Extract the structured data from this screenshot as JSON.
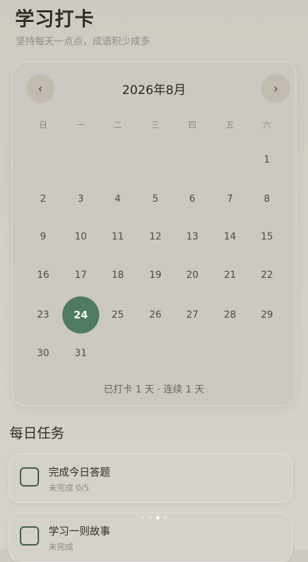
{
  "header": {
    "title": "学习打卡",
    "subtitle": "坚持每天一点点，成语积少成多"
  },
  "calendar": {
    "month_label": "2026年8月",
    "prev_icon": "chevron-left-icon",
    "next_icon": "chevron-right-icon",
    "prev_glyph": "‹",
    "next_glyph": "›",
    "weekdays": [
      "日",
      "一",
      "二",
      "三",
      "四",
      "五",
      "六"
    ],
    "first_weekday_index": 6,
    "days_in_month": 31,
    "selected_day": 24,
    "summary": "已打卡 1 天 · 连续 1 天"
  },
  "tasks_section": {
    "title": "每日任务",
    "tasks": [
      {
        "title": "完成今日答题",
        "status": "未完成 0/5"
      },
      {
        "title": "学习一则故事",
        "status": "未完成"
      }
    ]
  },
  "page_indicator": {
    "count": 4,
    "active_index": 2
  }
}
